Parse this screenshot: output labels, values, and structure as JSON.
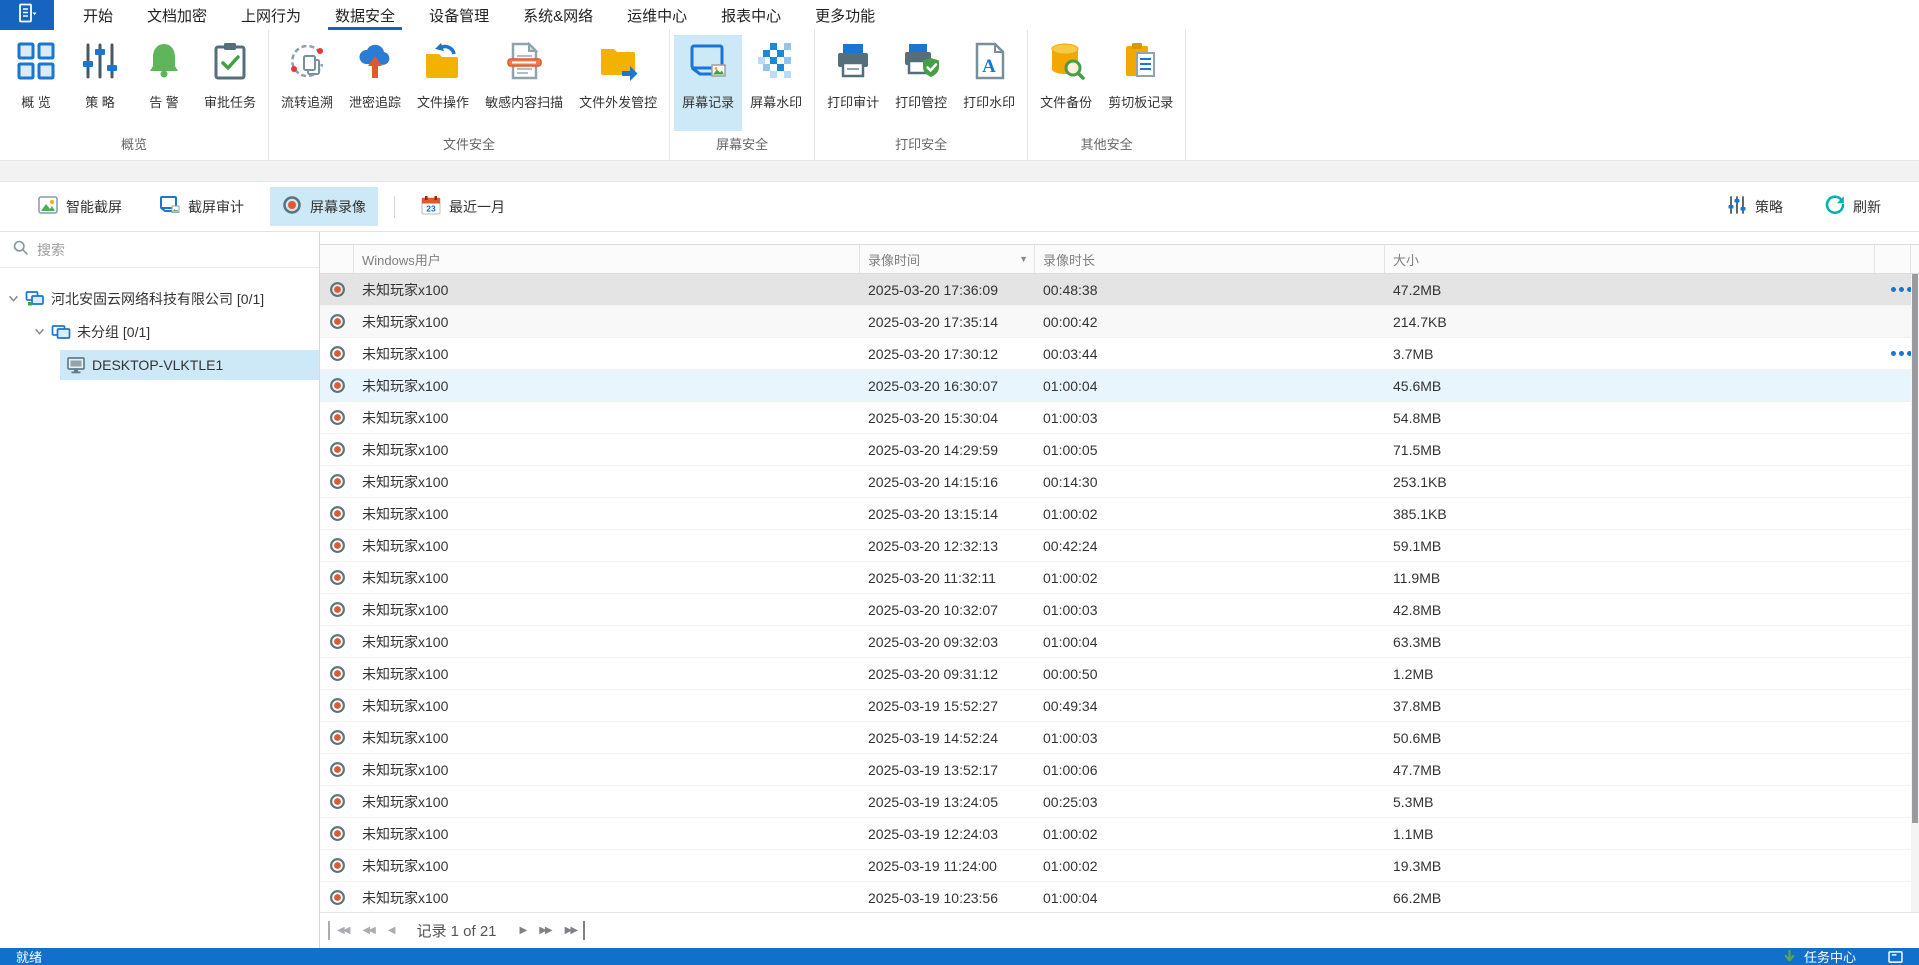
{
  "menu": {
    "tabs": [
      "开始",
      "文档加密",
      "上网行为",
      "数据安全",
      "设备管理",
      "系统&网络",
      "运维中心",
      "报表中心",
      "更多功能"
    ],
    "active_index": 3
  },
  "ribbon": {
    "groups": [
      {
        "label": "概览",
        "items": [
          {
            "label": "概 览"
          },
          {
            "label": "策 略"
          },
          {
            "label": "告 警"
          },
          {
            "label": "审批任务"
          }
        ]
      },
      {
        "label": "文件安全",
        "items": [
          {
            "label": "流转追溯"
          },
          {
            "label": "泄密追踪"
          },
          {
            "label": "文件操作"
          },
          {
            "label": "敏感内容扫描"
          },
          {
            "label": "文件外发管控"
          }
        ]
      },
      {
        "label": "屏幕安全",
        "items": [
          {
            "label": "屏幕记录",
            "active": true
          },
          {
            "label": "屏幕水印"
          }
        ]
      },
      {
        "label": "打印安全",
        "items": [
          {
            "label": "打印审计"
          },
          {
            "label": "打印管控"
          },
          {
            "label": "打印水印"
          }
        ]
      },
      {
        "label": "其他安全",
        "items": [
          {
            "label": "文件备份"
          },
          {
            "label": "剪切板记录"
          }
        ]
      }
    ]
  },
  "toolbar": {
    "buttons": [
      {
        "label": "智能截屏"
      },
      {
        "label": "截屏审计"
      },
      {
        "label": "屏幕录像",
        "active": true
      }
    ],
    "date_filter": {
      "label": "最近一月",
      "day": "23"
    },
    "right_buttons": [
      {
        "label": "策略"
      },
      {
        "label": "刷新"
      }
    ]
  },
  "sidebar": {
    "search_placeholder": "搜索",
    "tree": [
      {
        "label": "河北安固云网络科技有限公司 [0/1]"
      },
      {
        "label": "未分组 [0/1]"
      },
      {
        "label": "DESKTOP-VLKTLE1",
        "selected": true
      }
    ]
  },
  "table": {
    "columns": [
      "",
      "Windows用户",
      "录像时间",
      "录像时长",
      "大小"
    ],
    "rows": [
      {
        "user": "未知玩家x100",
        "time": "2025-03-20 17:36:09",
        "duration": "00:48:38",
        "size": "47.2MB",
        "more": true,
        "state": "selected"
      },
      {
        "user": "未知玩家x100",
        "time": "2025-03-20 17:35:14",
        "duration": "00:00:42",
        "size": "214.7KB",
        "more": false,
        "state": "alt"
      },
      {
        "user": "未知玩家x100",
        "time": "2025-03-20 17:30:12",
        "duration": "00:03:44",
        "size": "3.7MB",
        "more": true,
        "state": ""
      },
      {
        "user": "未知玩家x100",
        "time": "2025-03-20 16:30:07",
        "duration": "01:00:04",
        "size": "45.6MB",
        "more": false,
        "state": "hover"
      },
      {
        "user": "未知玩家x100",
        "time": "2025-03-20 15:30:04",
        "duration": "01:00:03",
        "size": "54.8MB",
        "more": false,
        "state": ""
      },
      {
        "user": "未知玩家x100",
        "time": "2025-03-20 14:29:59",
        "duration": "01:00:05",
        "size": "71.5MB",
        "more": false,
        "state": ""
      },
      {
        "user": "未知玩家x100",
        "time": "2025-03-20 14:15:16",
        "duration": "00:14:30",
        "size": "253.1KB",
        "more": false,
        "state": ""
      },
      {
        "user": "未知玩家x100",
        "time": "2025-03-20 13:15:14",
        "duration": "01:00:02",
        "size": "385.1KB",
        "more": false,
        "state": ""
      },
      {
        "user": "未知玩家x100",
        "time": "2025-03-20 12:32:13",
        "duration": "00:42:24",
        "size": "59.1MB",
        "more": false,
        "state": ""
      },
      {
        "user": "未知玩家x100",
        "time": "2025-03-20 11:32:11",
        "duration": "01:00:02",
        "size": "11.9MB",
        "more": false,
        "state": ""
      },
      {
        "user": "未知玩家x100",
        "time": "2025-03-20 10:32:07",
        "duration": "01:00:03",
        "size": "42.8MB",
        "more": false,
        "state": ""
      },
      {
        "user": "未知玩家x100",
        "time": "2025-03-20 09:32:03",
        "duration": "01:00:04",
        "size": "63.3MB",
        "more": false,
        "state": ""
      },
      {
        "user": "未知玩家x100",
        "time": "2025-03-20 09:31:12",
        "duration": "00:00:50",
        "size": "1.2MB",
        "more": false,
        "state": ""
      },
      {
        "user": "未知玩家x100",
        "time": "2025-03-19 15:52:27",
        "duration": "00:49:34",
        "size": "37.8MB",
        "more": false,
        "state": ""
      },
      {
        "user": "未知玩家x100",
        "time": "2025-03-19 14:52:24",
        "duration": "01:00:03",
        "size": "50.6MB",
        "more": false,
        "state": ""
      },
      {
        "user": "未知玩家x100",
        "time": "2025-03-19 13:52:17",
        "duration": "01:00:06",
        "size": "47.7MB",
        "more": false,
        "state": ""
      },
      {
        "user": "未知玩家x100",
        "time": "2025-03-19 13:24:05",
        "duration": "00:25:03",
        "size": "5.3MB",
        "more": false,
        "state": ""
      },
      {
        "user": "未知玩家x100",
        "time": "2025-03-19 12:24:03",
        "duration": "01:00:02",
        "size": "1.1MB",
        "more": false,
        "state": ""
      },
      {
        "user": "未知玩家x100",
        "time": "2025-03-19 11:24:00",
        "duration": "01:00:02",
        "size": "19.3MB",
        "more": false,
        "state": ""
      },
      {
        "user": "未知玩家x100",
        "time": "2025-03-19 10:23:56",
        "duration": "01:00:04",
        "size": "66.2MB",
        "more": false,
        "state": ""
      }
    ]
  },
  "pagination": {
    "label": "记录 1 of 21"
  },
  "statusbar": {
    "ready": "就绪",
    "task_center": "任务中心"
  },
  "colors": {
    "accent": "#1565c0",
    "active_item_bg": "#cde8f6",
    "statusbar_bg": "#1270cd",
    "record_red": "#e2572b",
    "selected_row_bg": "#e4e4e4",
    "hover_row_bg": "#e9f5fd",
    "refresh_teal": "#00b3b3",
    "task_arrow_green": "#5ea54b"
  }
}
